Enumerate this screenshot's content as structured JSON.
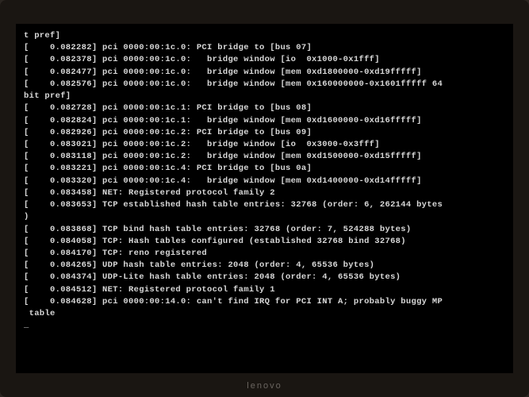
{
  "brand": "lenovo",
  "lines": [
    "t pref]",
    "[    0.082282] pci 0000:00:1c.0: PCI bridge to [bus 07]",
    "[    0.082378] pci 0000:00:1c.0:   bridge window [io  0x1000-0x1fff]",
    "[    0.082477] pci 0000:00:1c.0:   bridge window [mem 0xd1800000-0xd19fffff]",
    "[    0.082576] pci 0000:00:1c.0:   bridge window [mem 0x160000000-0x1601fffff 64",
    "bit pref]",
    "[    0.082728] pci 0000:00:1c.1: PCI bridge to [bus 08]",
    "[    0.082824] pci 0000:00:1c.1:   bridge window [mem 0xd1600000-0xd16fffff]",
    "[    0.082926] pci 0000:00:1c.2: PCI bridge to [bus 09]",
    "[    0.083021] pci 0000:00:1c.2:   bridge window [io  0x3000-0x3fff]",
    "[    0.083118] pci 0000:00:1c.2:   bridge window [mem 0xd1500000-0xd15fffff]",
    "[    0.083221] pci 0000:00:1c.4: PCI bridge to [bus 0a]",
    "[    0.083320] pci 0000:00:1c.4:   bridge window [mem 0xd1400000-0xd14fffff]",
    "[    0.083458] NET: Registered protocol family 2",
    "[    0.083653] TCP established hash table entries: 32768 (order: 6, 262144 bytes",
    ")",
    "[    0.083868] TCP bind hash table entries: 32768 (order: 7, 524288 bytes)",
    "[    0.084058] TCP: Hash tables configured (established 32768 bind 32768)",
    "[    0.084170] TCP: reno registered",
    "[    0.084265] UDP hash table entries: 2048 (order: 4, 65536 bytes)",
    "[    0.084374] UDP-Lite hash table entries: 2048 (order: 4, 65536 bytes)",
    "[    0.084512] NET: Registered protocol family 1",
    "[    0.084628] pci 0000:00:14.0: can't find IRQ for PCI INT A; probably buggy MP",
    " table",
    "_"
  ]
}
